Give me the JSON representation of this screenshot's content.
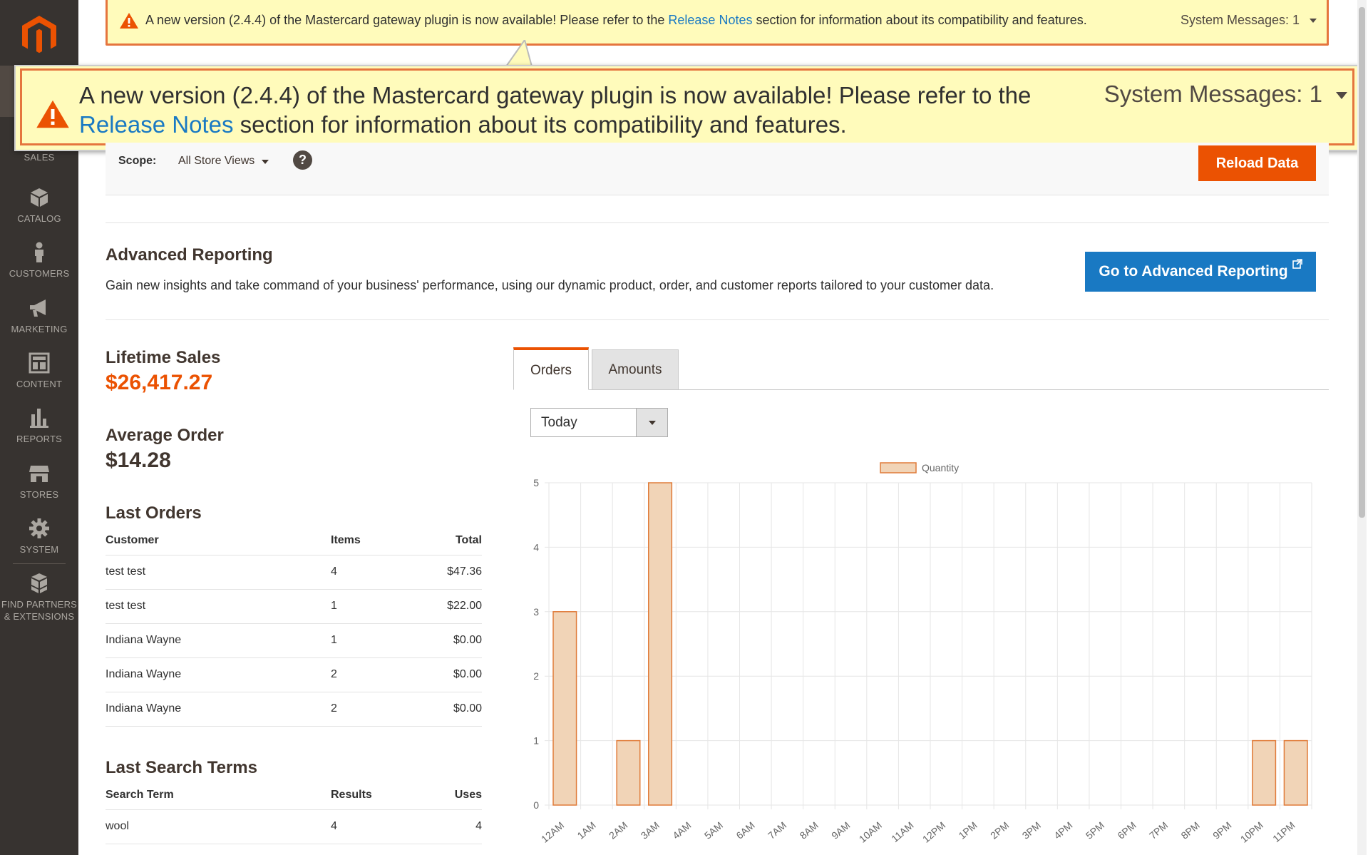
{
  "sidebar": {
    "items": [
      {
        "label": "SALES",
        "icon": "dollar-icon"
      },
      {
        "label": "CATALOG",
        "icon": "box-icon"
      },
      {
        "label": "CUSTOMERS",
        "icon": "person-icon"
      },
      {
        "label": "MARKETING",
        "icon": "megaphone-icon"
      },
      {
        "label": "CONTENT",
        "icon": "layout-icon"
      },
      {
        "label": "REPORTS",
        "icon": "bar-chart-icon"
      },
      {
        "label": "STORES",
        "icon": "store-icon"
      },
      {
        "label": "SYSTEM",
        "icon": "gear-icon"
      },
      {
        "label": "FIND PARTNERS",
        "label2": "& EXTENSIONS",
        "icon": "cubes-icon"
      }
    ]
  },
  "system_message": {
    "text_before": "A new version (2.4.4) of the Mastercard gateway plugin is now available! Please refer to the ",
    "link_text": "Release Notes",
    "text_after": " section for information about its compatibility and features.",
    "counter": "System Messages: 1"
  },
  "scope": {
    "label": "Scope:",
    "value": "All Store Views",
    "help": "?",
    "reload_label": "Reload Data"
  },
  "advanced_reporting": {
    "title": "Advanced Reporting",
    "description": "Gain new insights and take command of your business' performance, using our dynamic product, order, and customer reports tailored to your customer data.",
    "button_label": "Go to Advanced Reporting"
  },
  "lifetime_sales": {
    "title": "Lifetime Sales",
    "value": "$26,417.27"
  },
  "average_order": {
    "title": "Average Order",
    "value": "$14.28"
  },
  "last_orders": {
    "title": "Last Orders",
    "headers": [
      "Customer",
      "Items",
      "Total"
    ],
    "rows": [
      [
        "test test",
        "4",
        "$47.36"
      ],
      [
        "test test",
        "1",
        "$22.00"
      ],
      [
        "Indiana Wayne",
        "1",
        "$0.00"
      ],
      [
        "Indiana Wayne",
        "2",
        "$0.00"
      ],
      [
        "Indiana Wayne",
        "2",
        "$0.00"
      ]
    ]
  },
  "last_search_terms": {
    "title": "Last Search Terms",
    "headers": [
      "Search Term",
      "Results",
      "Uses"
    ],
    "rows": [
      [
        "wool",
        "4",
        "4"
      ]
    ]
  },
  "tabs": [
    {
      "label": "Orders",
      "active": true
    },
    {
      "label": "Amounts",
      "active": false
    }
  ],
  "period_select": {
    "value": "Today"
  },
  "colors": {
    "accent": "#eb5202",
    "link": "#1979c3",
    "sidebar": "#373330",
    "bar_fill": "#f1d4b7",
    "bar_stroke": "#e07b39"
  },
  "chart_data": {
    "type": "bar",
    "categories": [
      "12AM",
      "1AM",
      "2AM",
      "3AM",
      "4AM",
      "5AM",
      "6AM",
      "7AM",
      "8AM",
      "9AM",
      "10AM",
      "11AM",
      "12PM",
      "1PM",
      "2PM",
      "3PM",
      "4PM",
      "5PM",
      "6PM",
      "7PM",
      "8PM",
      "9PM",
      "10PM",
      "11PM"
    ],
    "series": [
      {
        "name": "Quantity",
        "values": [
          3,
          0,
          1,
          5,
          0,
          0,
          0,
          0,
          0,
          0,
          0,
          0,
          0,
          0,
          0,
          0,
          0,
          0,
          0,
          0,
          0,
          0,
          1,
          1
        ]
      }
    ],
    "yticks": [
      "0",
      "1",
      "2",
      "3",
      "4",
      "5"
    ],
    "ylim": [
      0,
      5
    ],
    "grid": true,
    "legend": "top-center"
  }
}
